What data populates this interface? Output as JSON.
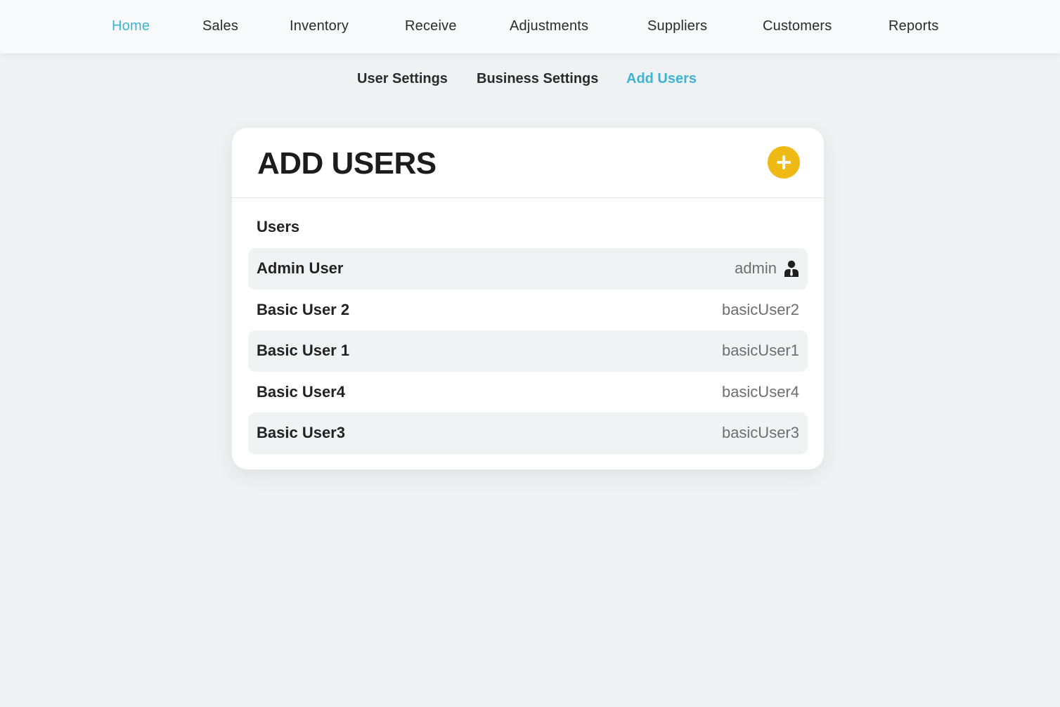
{
  "nav": {
    "items": [
      {
        "label": "Home",
        "active": true
      },
      {
        "label": "Sales"
      },
      {
        "label": "Inventory"
      },
      {
        "label": "Receive"
      },
      {
        "label": "Adjustments"
      },
      {
        "label": "Suppliers"
      },
      {
        "label": "Customers"
      },
      {
        "label": "Reports"
      }
    ]
  },
  "subnav": {
    "items": [
      {
        "label": "User Settings"
      },
      {
        "label": "Business Settings"
      },
      {
        "label": "Add Users",
        "active": true
      }
    ]
  },
  "card": {
    "title": "ADD USERS",
    "add_icon": "plus-circle-icon",
    "section_label": "Users",
    "users": [
      {
        "name": "Admin User",
        "username": "admin",
        "icon": "admin-user-icon"
      },
      {
        "name": "Basic User 2",
        "username": "basicUser2"
      },
      {
        "name": "Basic User 1",
        "username": "basicUser1"
      },
      {
        "name": "Basic User4",
        "username": "basicUser4"
      },
      {
        "name": "Basic User3",
        "username": "basicUser3"
      }
    ]
  },
  "colors": {
    "accent": "#3bb4d6",
    "add_button": "#efba15",
    "background": "#f0f1f3"
  }
}
